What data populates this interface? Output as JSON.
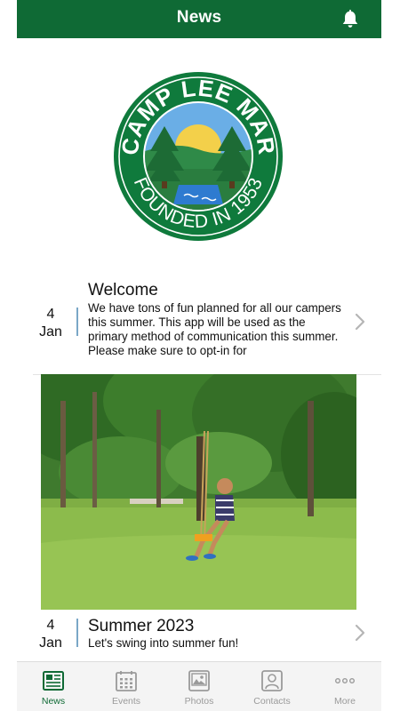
{
  "header": {
    "title": "News"
  },
  "logo": {
    "name": "CAMP LEE MAR",
    "founded": "FOUNDED IN 1953"
  },
  "news": [
    {
      "day": "4",
      "month": "Jan",
      "title": "Welcome",
      "body": "We have tons of fun planned for all our campers this summer.  This app will be used as the primary method of communication this summer. Please make sure to opt-in for"
    },
    {
      "day": "4",
      "month": "Jan",
      "title": "Summer 2023",
      "body": "Let's swing into summer fun!"
    }
  ],
  "tabs": [
    {
      "label": "News",
      "icon": "newspaper-icon",
      "active": true
    },
    {
      "label": "Events",
      "icon": "calendar-icon",
      "active": false
    },
    {
      "label": "Photos",
      "icon": "photo-icon",
      "active": false
    },
    {
      "label": "Contacts",
      "icon": "contact-icon",
      "active": false
    },
    {
      "label": "More",
      "icon": "more-icon",
      "active": false
    }
  ],
  "colors": {
    "brand_green": "#0f6a35",
    "date_bar": "#7aa7c7",
    "tab_inactive": "#9a9a9a"
  }
}
